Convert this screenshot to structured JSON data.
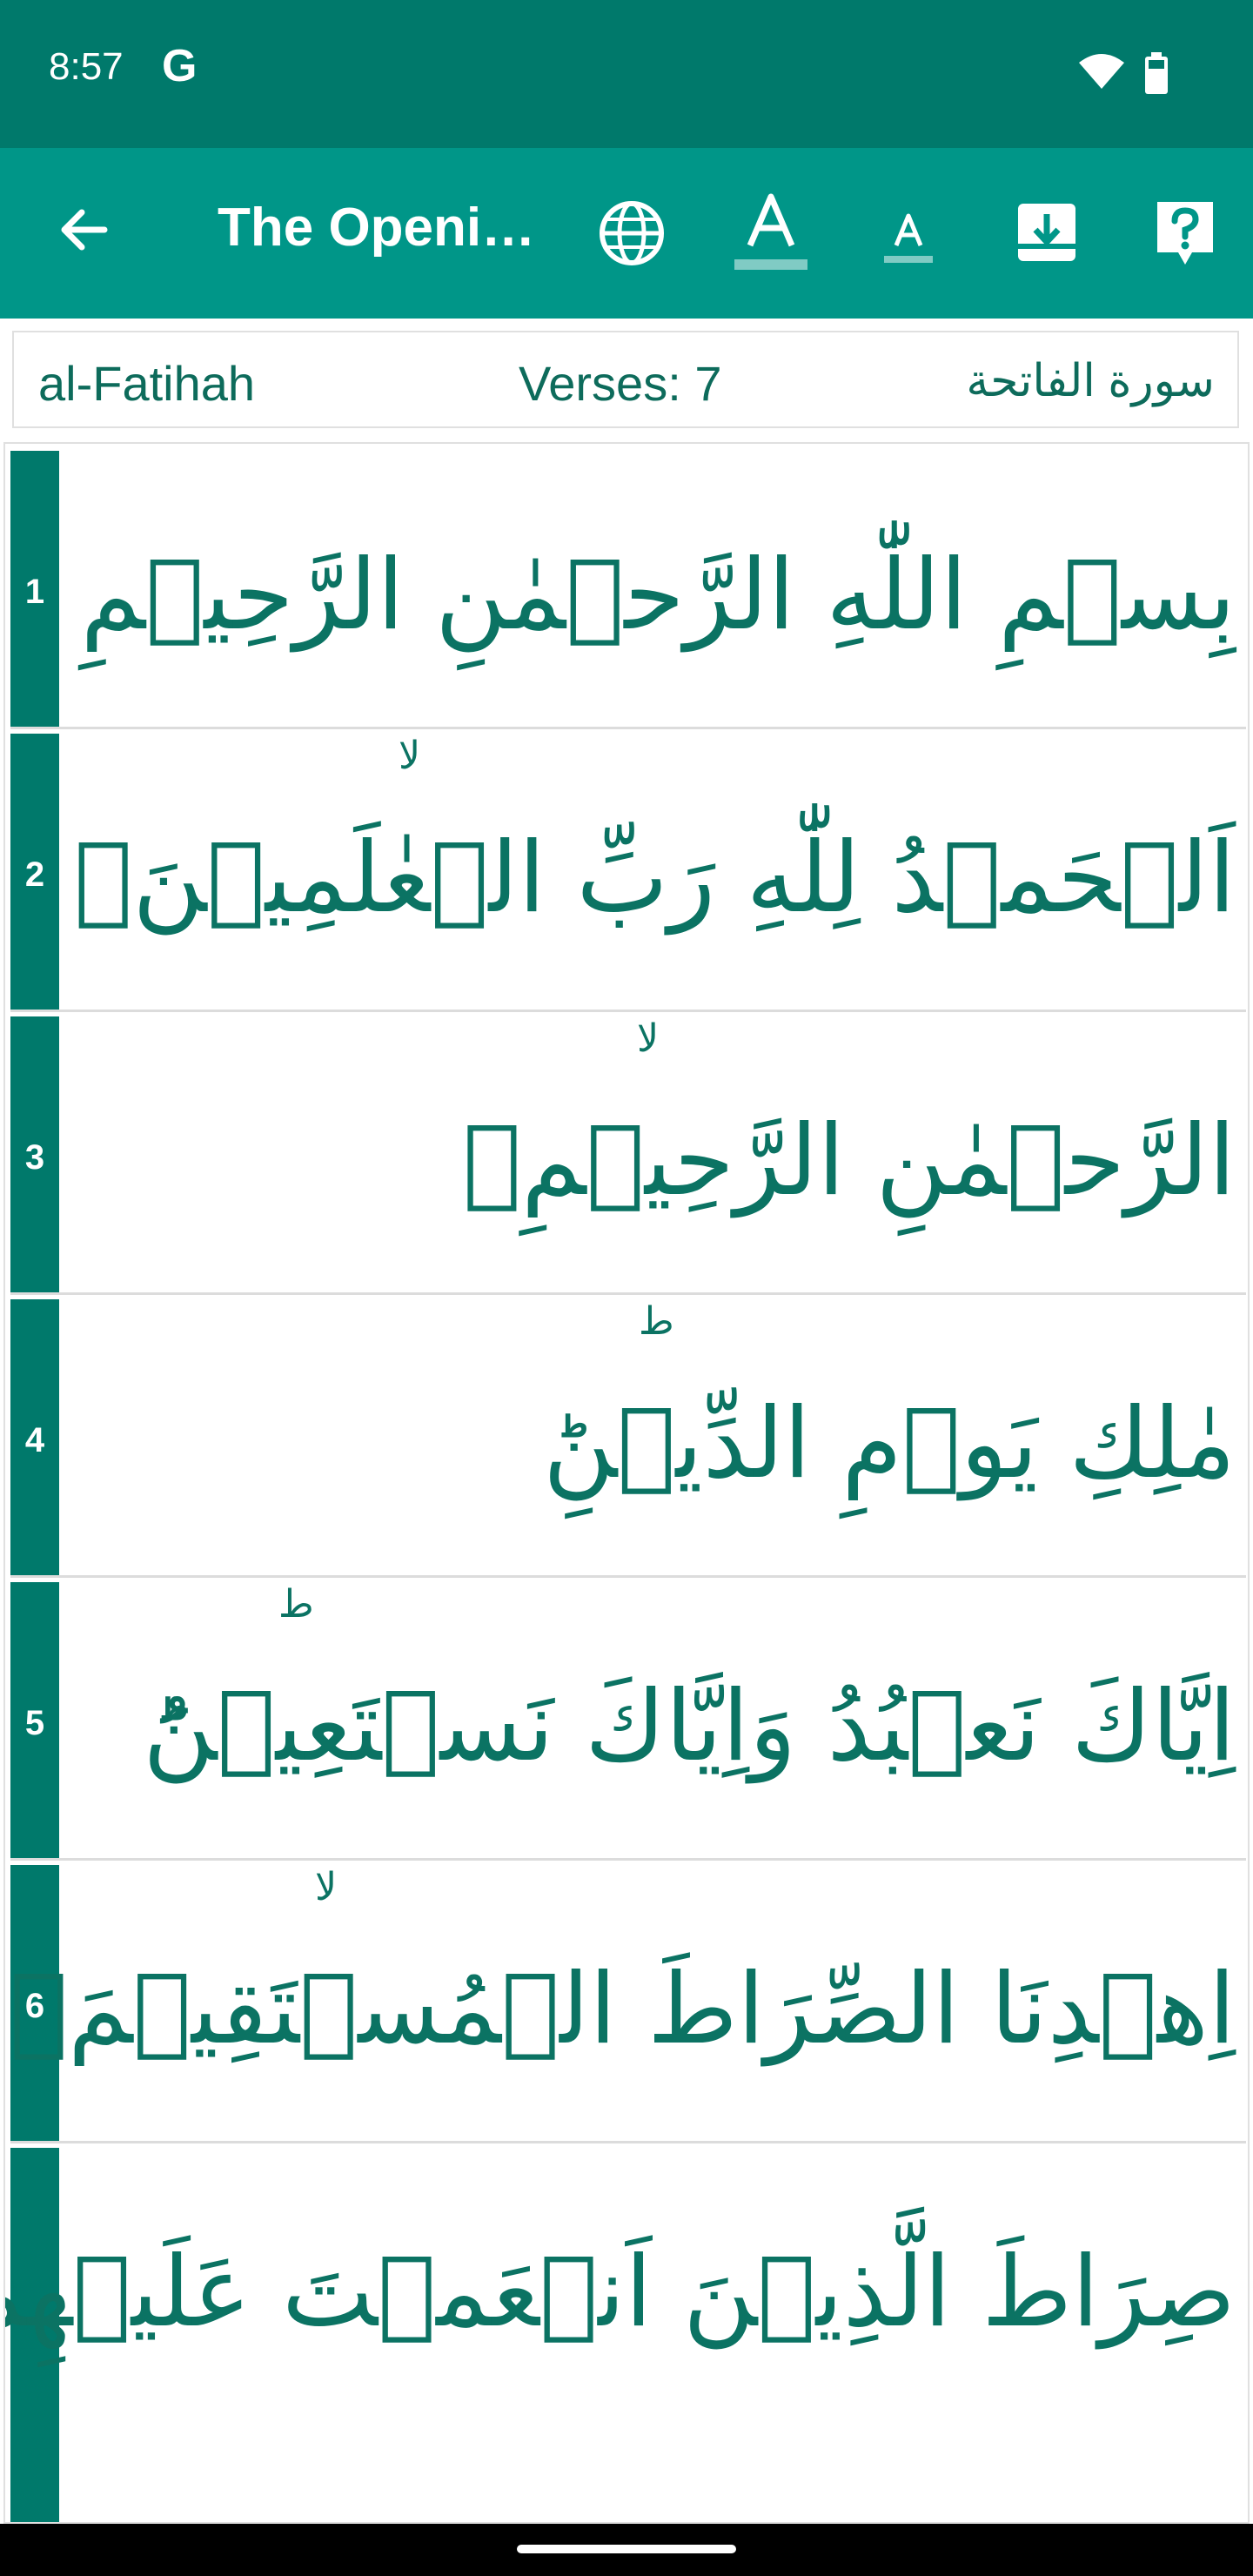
{
  "status_bar": {
    "time": "8:57",
    "g_logo": "G",
    "icons": [
      "wifi-icon",
      "battery-icon"
    ]
  },
  "app_bar": {
    "title": "The Opening",
    "icons": [
      "back-arrow-icon",
      "globe-icon",
      "font-size-increase-icon",
      "font-size-decrease-icon",
      "download-icon",
      "help-icon"
    ]
  },
  "surah_info": {
    "name_latin": "al-Fatihah",
    "verses": "Verses: 7",
    "name_arabic": "سورة الفاتحة"
  },
  "verses": [
    {
      "number": "1",
      "text": "بِسۡمِ اللّٰهِ الرَّحۡمٰنِ الرَّحِيۡمِ",
      "waqf": ""
    },
    {
      "number": "2",
      "text": "اَلۡحَمۡدُ لِلّٰهِ رَبِّ الۡعٰلَمِيۡنَۙ",
      "waqf": "لا"
    },
    {
      "number": "3",
      "text": "الرَّحۡمٰنِ الرَّحِيۡمِۙ",
      "waqf": "لا"
    },
    {
      "number": "4",
      "text": "مٰلِكِ يَوۡمِ الدِّيۡنِؕ",
      "waqf": "ط"
    },
    {
      "number": "5",
      "text": "اِيَّاكَ نَعۡبُدُ وَاِيَّاكَ نَسۡتَعِيۡنُؕ",
      "waqf": "ط"
    },
    {
      "number": "6",
      "text": "اِهۡدِنَا الصِّرَاطَ الۡمُسۡتَقِيۡمَۙ",
      "waqf": "لا"
    },
    {
      "number": "",
      "text": "صِرَاطَ الَّذِيۡنَ اَنۡعَمۡتَ عَلَيۡهِمۡ",
      "waqf": ""
    }
  ],
  "colors": {
    "status_bar": "#00796b",
    "app_bar": "#009688",
    "verse_strip": "#00796b",
    "arabic_text": "#0b7363"
  }
}
